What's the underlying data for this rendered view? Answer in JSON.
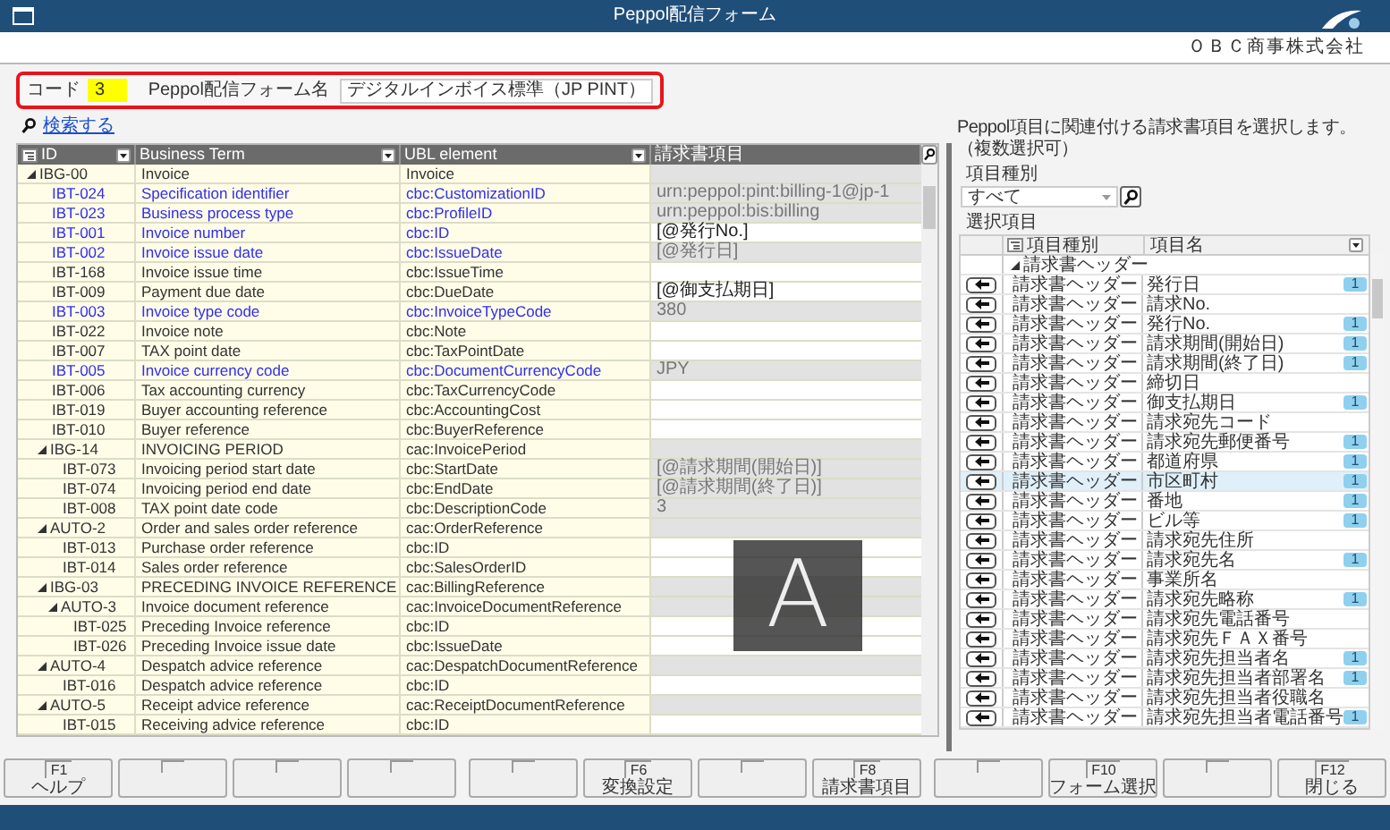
{
  "window": {
    "title": "Peppol配信フォーム"
  },
  "company": "ＯＢＣ商事株式会社",
  "form": {
    "code_label": "コード",
    "code": "3",
    "name_label": "Peppol配信フォーム名",
    "name": "デジタルインボイス標準（JP PINT）"
  },
  "search_link": "検索する",
  "mapping_table": {
    "columns": [
      "ID",
      "Business Term",
      "UBL element",
      "請求書項目"
    ],
    "rows": [
      {
        "id": "IBG-00",
        "term": "Invoice",
        "ubl": "Invoice",
        "disabled": true,
        "linked": false,
        "expanded": true,
        "children": [
          {
            "id": "IBT-024",
            "term": "Specification identifier",
            "ubl": "cbc:CustomizationID",
            "value": "urn:peppol:pint:billing-1@jp-1",
            "disabled": true,
            "linked": true
          },
          {
            "id": "IBT-023",
            "term": "Business process type",
            "ubl": "cbc:ProfileID",
            "value": "urn:peppol:bis:billing",
            "disabled": true,
            "linked": true
          },
          {
            "id": "IBT-001",
            "term": "Invoice number",
            "ubl": "cbc:ID",
            "value": "[@発行No.]",
            "disabled": false,
            "linked": true
          },
          {
            "id": "IBT-002",
            "term": "Invoice issue date",
            "ubl": "cbc:IssueDate",
            "value": "[@発行日]",
            "disabled": true,
            "linked": true
          },
          {
            "id": "IBT-168",
            "term": "Invoice issue time",
            "ubl": "cbc:IssueTime",
            "disabled": false,
            "linked": false
          },
          {
            "id": "IBT-009",
            "term": "Payment due date",
            "ubl": "cbc:DueDate",
            "value": "[@御支払期日]",
            "disabled": false,
            "linked": false
          },
          {
            "id": "IBT-003",
            "term": "Invoice type code",
            "ubl": "cbc:InvoiceTypeCode",
            "value": "380",
            "disabled": true,
            "linked": true
          },
          {
            "id": "IBT-022",
            "term": "Invoice note",
            "ubl": "cbc:Note",
            "disabled": false,
            "linked": false
          },
          {
            "id": "IBT-007",
            "term": "TAX point date",
            "ubl": "cbc:TaxPointDate",
            "disabled": false,
            "linked": false
          },
          {
            "id": "IBT-005",
            "term": "Invoice currency code",
            "ubl": "cbc:DocumentCurrencyCode",
            "value": "JPY",
            "disabled": true,
            "linked": true
          },
          {
            "id": "IBT-006",
            "term": "Tax accounting currency",
            "ubl": "cbc:TaxCurrencyCode",
            "disabled": false,
            "linked": false
          },
          {
            "id": "IBT-019",
            "term": "Buyer accounting reference",
            "ubl": "cbc:AccountingCost",
            "disabled": false,
            "linked": false
          },
          {
            "id": "IBT-010",
            "term": "Buyer reference",
            "ubl": "cbc:BuyerReference",
            "disabled": false,
            "linked": false
          },
          {
            "id": "IBG-14",
            "term": "INVOICING PERIOD",
            "ubl": "cac:InvoicePeriod",
            "disabled": true,
            "linked": false,
            "expanded": true,
            "children": [
              {
                "id": "IBT-073",
                "term": "Invoicing period start date",
                "ubl": "cbc:StartDate",
                "value": "[@請求期間(開始日)]",
                "disabled": true,
                "linked": false
              },
              {
                "id": "IBT-074",
                "term": "Invoicing period end date",
                "ubl": "cbc:EndDate",
                "value": "[@請求期間(終了日)]",
                "disabled": true,
                "linked": false
              },
              {
                "id": "IBT-008",
                "term": "TAX point date code",
                "ubl": "cbc:DescriptionCode",
                "value": "3",
                "disabled": true,
                "linked": false
              }
            ]
          },
          {
            "id": "AUTO-2",
            "term": "Order and sales order reference",
            "ubl": "cac:OrderReference",
            "disabled": true,
            "linked": false,
            "expanded": true,
            "children": [
              {
                "id": "IBT-013",
                "term": "Purchase order reference",
                "ubl": "cbc:ID",
                "disabled": false,
                "linked": false
              },
              {
                "id": "IBT-014",
                "term": "Sales order reference",
                "ubl": "cbc:SalesOrderID",
                "disabled": false,
                "linked": false
              }
            ]
          },
          {
            "id": "IBG-03",
            "term": "PRECEDING INVOICE REFERENCE",
            "ubl": "cac:BillingReference",
            "disabled": true,
            "linked": false,
            "expanded": true,
            "children": [
              {
                "id": "AUTO-3",
                "term": "Invoice document reference",
                "ubl": "cac:InvoiceDocumentReference",
                "disabled": true,
                "linked": false,
                "expanded": true,
                "children": [
                  {
                    "id": "IBT-025",
                    "term": "Preceding Invoice reference",
                    "ubl": "cbc:ID",
                    "disabled": false,
                    "linked": false
                  },
                  {
                    "id": "IBT-026",
                    "term": "Preceding Invoice issue date",
                    "ubl": "cbc:IssueDate",
                    "disabled": false,
                    "linked": false
                  }
                ]
              }
            ]
          },
          {
            "id": "AUTO-4",
            "term": "Despatch advice reference",
            "ubl": "cac:DespatchDocumentReference",
            "disabled": true,
            "linked": false,
            "expanded": true,
            "children": [
              {
                "id": "IBT-016",
                "term": "Despatch advice reference",
                "ubl": "cbc:ID",
                "disabled": false,
                "linked": false
              }
            ]
          },
          {
            "id": "AUTO-5",
            "term": "Receipt advice reference",
            "ubl": "cac:ReceiptDocumentReference",
            "disabled": true,
            "linked": false,
            "expanded": true,
            "children": [
              {
                "id": "IBT-015",
                "term": "Receiving advice reference",
                "ubl": "cbc:ID",
                "disabled": false,
                "linked": false
              }
            ]
          }
        ]
      }
    ]
  },
  "ime_indicator": "A",
  "item_panel": {
    "instruction": "Peppol項目に関連付ける請求書項目を選択します。（複数選択可）",
    "type_label": "項目種別",
    "type_value": "すべて",
    "list_label": "選択項目",
    "columns": [
      "項目種別",
      "項目名"
    ],
    "groups": [
      {
        "type": "請求書ヘッダー",
        "expanded": true,
        "children": [
          {
            "type": "請求書ヘッダー",
            "name": "発行日",
            "count": "1",
            "selected": false
          },
          {
            "type": "請求書ヘッダー",
            "name": "請求No.",
            "selected": false
          },
          {
            "type": "請求書ヘッダー",
            "name": "発行No.",
            "count": "1",
            "selected": false
          },
          {
            "type": "請求書ヘッダー",
            "name": "請求期間(開始日)",
            "count": "1",
            "selected": false
          },
          {
            "type": "請求書ヘッダー",
            "name": "請求期間(終了日)",
            "count": "1",
            "selected": false
          },
          {
            "type": "請求書ヘッダー",
            "name": "締切日",
            "selected": false
          },
          {
            "type": "請求書ヘッダー",
            "name": "御支払期日",
            "count": "1",
            "selected": false
          },
          {
            "type": "請求書ヘッダー",
            "name": "請求宛先コード",
            "selected": false
          },
          {
            "type": "請求書ヘッダー",
            "name": "請求宛先郵便番号",
            "count": "1",
            "selected": false
          },
          {
            "type": "請求書ヘッダー",
            "name": "都道府県",
            "count": "1",
            "selected": false
          },
          {
            "type": "請求書ヘッダー",
            "name": "市区町村",
            "count": "1",
            "selected": true
          },
          {
            "type": "請求書ヘッダー",
            "name": "番地",
            "count": "1",
            "selected": false
          },
          {
            "type": "請求書ヘッダー",
            "name": "ビル等",
            "count": "1",
            "selected": false
          },
          {
            "type": "請求書ヘッダー",
            "name": "請求宛先住所",
            "selected": false
          },
          {
            "type": "請求書ヘッダー",
            "name": "請求宛先名",
            "count": "1",
            "selected": false
          },
          {
            "type": "請求書ヘッダー",
            "name": "事業所名",
            "selected": false
          },
          {
            "type": "請求書ヘッダー",
            "name": "請求宛先略称",
            "count": "1",
            "selected": false
          },
          {
            "type": "請求書ヘッダー",
            "name": "請求宛先電話番号",
            "selected": false
          },
          {
            "type": "請求書ヘッダー",
            "name": "請求宛先ＦＡＸ番号",
            "selected": false
          },
          {
            "type": "請求書ヘッダー",
            "name": "請求宛先担当者名",
            "count": "1",
            "selected": false
          },
          {
            "type": "請求書ヘッダー",
            "name": "請求宛先担当者部署名",
            "count": "1",
            "selected": false
          },
          {
            "type": "請求書ヘッダー",
            "name": "請求宛先担当者役職名",
            "selected": false
          },
          {
            "type": "請求書ヘッダー",
            "name": "請求宛先担当者電話番号",
            "count": "1",
            "selected": false
          }
        ]
      }
    ]
  },
  "function_keys": [
    {
      "kind": "key",
      "key": "F1",
      "label": "ヘルプ"
    },
    {
      "kind": "blank"
    },
    {
      "kind": "blank"
    },
    {
      "kind": "blank"
    },
    {
      "kind": "blank"
    },
    {
      "kind": "key",
      "key": "F6",
      "label": "変換設定"
    },
    {
      "kind": "blank"
    },
    {
      "kind": "key",
      "key": "F8",
      "label": "請求書項目"
    },
    {
      "kind": "blank"
    },
    {
      "kind": "key",
      "key": "F10",
      "label": "フォーム選択"
    },
    {
      "kind": "blank"
    },
    {
      "kind": "key",
      "key": "F12",
      "label": "閉じる"
    }
  ]
}
